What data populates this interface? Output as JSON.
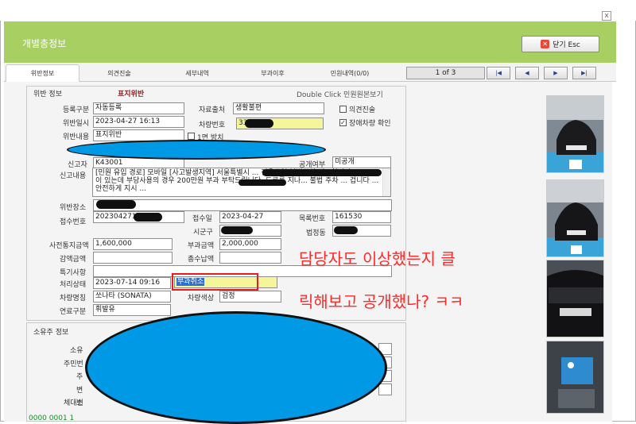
{
  "window": {
    "close_glyph": "x"
  },
  "header": {
    "title": "개별총정보",
    "close_button": "닫기 Esc"
  },
  "tabs": [
    "위반정보",
    "의견진술",
    "세부내역",
    "부과이후",
    "민원내역(0/0)"
  ],
  "pager": {
    "text": "1 of 3",
    "first": "|◀",
    "prev": "◀",
    "next": "▶",
    "last": "▶|"
  },
  "violation": {
    "section_title": "위반 정보",
    "type_badge": "표지위반",
    "double_click_hint": "Double Click  민원원본보기",
    "labels": {
      "register_type": "등록구분",
      "data_source": "자료출처",
      "opinion": "의견진술",
      "violation_datetime": "위반일시",
      "vehicle_no": "차량번호",
      "disabled_vehicle_check": "장애차량 확인",
      "violation_content": "위반내용",
      "one_hour": "1면 방치",
      "reporter": "신고자",
      "disclosure": "공개여부",
      "report_content": "신고내용",
      "violation_place": "위반장소",
      "receipt_no": "접수번호",
      "receipt_date": "접수일",
      "list_no": "목록번호",
      "sigungu": "시군구",
      "dong": "법정동",
      "pre_notice_amount": "사전통지금액",
      "levy_amount": "부과금액",
      "reduced_amount": "감액금액",
      "total_paid": "총수납액",
      "special_notes": "특기사항",
      "process_status": "처리상태",
      "car_model": "차량명칭",
      "car_color": "차량색상",
      "fuel": "연료구분"
    },
    "values": {
      "register_type": "자동등록",
      "data_source": "생활불편",
      "violation_datetime": "2023-04-27 16:13",
      "vehicle_no": "330",
      "violation_content": "표지위반",
      "reporter": "K43001",
      "disclosure": "미공개",
      "report_content": "[민원 유입 경로] 모바일 [사고발생지역] 서울특별시 ... 전용구역 불법주차 신고합니다. 330 ... 이 있는데 부당사용의 경우 200만원 부과 부탁드립니다. 도로를 지나... 불법 주차 ... 겁니다 ... 안전하게 지시 ...",
      "receipt_no": "20230427163",
      "receipt_date": "2023-04-27",
      "list_no": "161530",
      "sigungu": "",
      "dong": "",
      "pre_notice_amount": "1,600,000",
      "levy_amount": "2,000,000",
      "reduced_amount": "",
      "total_paid": "",
      "special_notes": "",
      "process_date": "2023-07-14 09:16",
      "process_status": "부과취소",
      "car_model": "쏘나타 (SONATA)",
      "car_color": "검정",
      "fuel": "휘발유"
    },
    "checks": {
      "opinion": false,
      "disabled_vehicle_check": true,
      "one_hour": false
    }
  },
  "owner": {
    "section_title": "소유주 정보",
    "labels": [
      "소유",
      "주민번",
      "주",
      "변",
      "소",
      "체대번"
    ],
    "footer_number": "0000 0001 1"
  },
  "overlay": {
    "line1": "담당자도 이상했는지 클",
    "line2": "릭해보고 공개했나? ㅋㅋ"
  },
  "colors": {
    "header_green": "#a7cf62",
    "highlight_yellow": "#f5f69a",
    "annotation_red": "#ff2a2a",
    "redaction_blue": "#0099e6"
  }
}
